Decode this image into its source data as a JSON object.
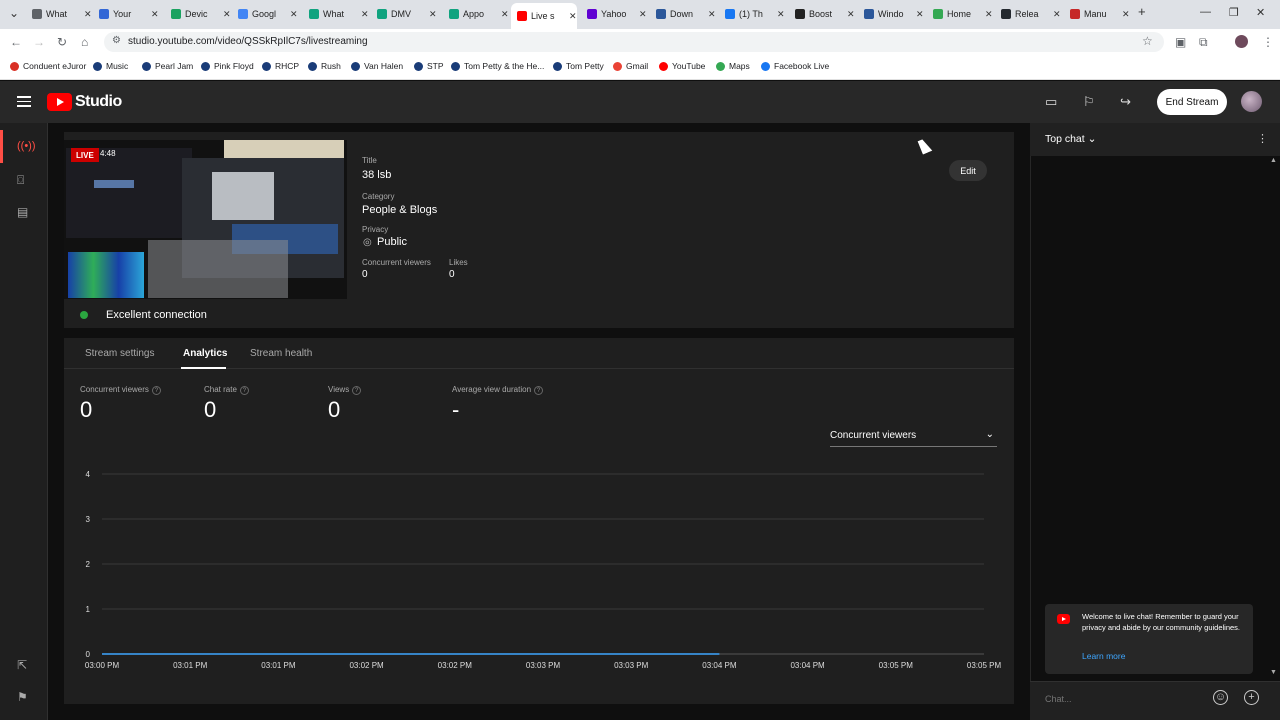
{
  "browser": {
    "tabs": [
      {
        "label": "What",
        "color": "#5f6368"
      },
      {
        "label": "Your",
        "color": "#3367d6"
      },
      {
        "label": "Devic",
        "color": "#1aa260"
      },
      {
        "label": "Googl",
        "color": "#4285f4"
      },
      {
        "label": "What",
        "color": "#10a37f"
      },
      {
        "label": "DMV",
        "color": "#10a37f"
      },
      {
        "label": "Appo",
        "color": "#10a37f"
      },
      {
        "label": "Live s",
        "color": "#ff0000"
      },
      {
        "label": "Yahoo",
        "color": "#6001d2"
      },
      {
        "label": "Down",
        "color": "#2b579a"
      },
      {
        "label": "(1) Th",
        "color": "#1877f2"
      },
      {
        "label": "Boost",
        "color": "#222222"
      },
      {
        "label": "Windo",
        "color": "#2b579a"
      },
      {
        "label": "Home",
        "color": "#34a853"
      },
      {
        "label": "Relea",
        "color": "#24292f"
      },
      {
        "label": "Manu",
        "color": "#c62828"
      }
    ],
    "url": "studio.youtube.com/video/QSSkRpIlC7s/livestreaming",
    "bookmarks": [
      {
        "label": "Conduent eJuror",
        "color": "#d93025"
      },
      {
        "label": "Music",
        "color": "#1a3c78"
      },
      {
        "label": "Pearl Jam",
        "color": "#1a3c78"
      },
      {
        "label": "Pink Floyd",
        "color": "#1a3c78"
      },
      {
        "label": "RHCP",
        "color": "#1a3c78"
      },
      {
        "label": "Rush",
        "color": "#1a3c78"
      },
      {
        "label": "Van Halen",
        "color": "#1a3c78"
      },
      {
        "label": "STP",
        "color": "#1a3c78"
      },
      {
        "label": "Tom Petty & the He...",
        "color": "#1a3c78"
      },
      {
        "label": "Tom Petty",
        "color": "#1a3c78"
      },
      {
        "label": "Gmail",
        "color": "#ea4335"
      },
      {
        "label": "YouTube",
        "color": "#ff0000"
      },
      {
        "label": "Maps",
        "color": "#34a853"
      },
      {
        "label": "Facebook Live",
        "color": "#1877f2"
      }
    ]
  },
  "header": {
    "logo_text": "Studio",
    "end_stream_label": "End Stream"
  },
  "stream": {
    "live_badge": "LIVE",
    "live_time": "4:48",
    "title_label": "Title",
    "title": "38 lsb",
    "category_label": "Category",
    "category": "People & Blogs",
    "privacy_label": "Privacy",
    "privacy": "Public",
    "concurrent_label": "Concurrent viewers",
    "concurrent": "0",
    "likes_label": "Likes",
    "likes": "0",
    "edit_label": "Edit",
    "connection": "Excellent connection",
    "connection_color": "#2ba640"
  },
  "tabs": {
    "stream_settings": "Stream settings",
    "analytics": "Analytics",
    "stream_health": "Stream health"
  },
  "analytics": {
    "stats": [
      {
        "label": "Concurrent viewers",
        "value": "0"
      },
      {
        "label": "Chat rate",
        "value": "0"
      },
      {
        "label": "Views",
        "value": "0"
      },
      {
        "label": "Average view duration",
        "value": "-"
      }
    ],
    "dropdown": "Concurrent viewers"
  },
  "chart_data": {
    "type": "line",
    "title": "",
    "xlabel": "",
    "ylabel": "",
    "categories": [
      "03:00 PM",
      "03:01 PM",
      "03:01 PM",
      "03:02 PM",
      "03:02 PM",
      "03:03 PM",
      "03:03 PM",
      "03:04 PM",
      "03:04 PM",
      "03:05 PM",
      "03:05 PM"
    ],
    "values": [
      0,
      0,
      0,
      0,
      0,
      0,
      0,
      0,
      0,
      0,
      0
    ],
    "yticks": [
      0,
      1,
      2,
      3,
      4
    ],
    "ylim": [
      0,
      4
    ],
    "grid": true,
    "line_color": "#3ea6ff"
  },
  "chat": {
    "header": "Top chat",
    "welcome": "Welcome to live chat! Remember to guard your privacy and abide by our community guidelines.",
    "learn_more": "Learn more",
    "placeholder": "Chat..."
  }
}
